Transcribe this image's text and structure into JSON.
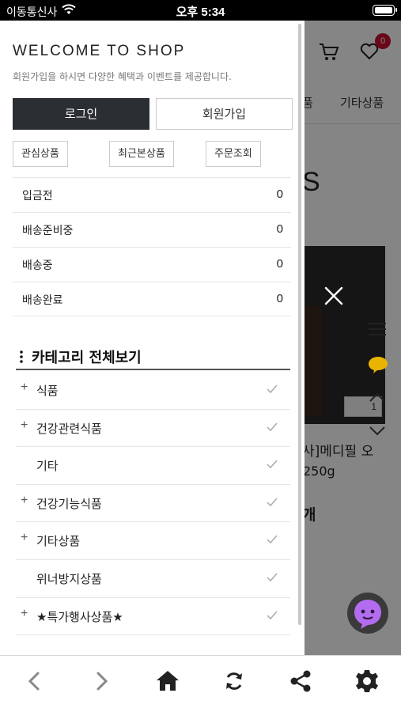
{
  "status_bar": {
    "carrier": "이동통신사",
    "time": "오후 5:34"
  },
  "background": {
    "cart_count": "0",
    "tabs": [
      "품",
      "기타상품"
    ],
    "big_text": "S",
    "like_count": "1",
    "product_name": "사]메디필 오",
    "product_weight": "250g",
    "count_label": "개"
  },
  "drawer": {
    "title": "WELCOME TO SHOP",
    "subtitle": "회원가입을 하시면 다양한 혜택과 이벤트를 제공합니다.",
    "login_label": "로그인",
    "join_label": "회원가입",
    "quick_buttons": [
      "관심상품",
      "최근본상품",
      "주문조회"
    ],
    "order_status": [
      {
        "label": "입금전",
        "count": "0"
      },
      {
        "label": "배송준비중",
        "count": "0"
      },
      {
        "label": "배송중",
        "count": "0"
      },
      {
        "label": "배송완료",
        "count": "0"
      }
    ],
    "category_title": "카테고리 전체보기",
    "categories": [
      {
        "plus": "+",
        "name": "식품"
      },
      {
        "plus": "+",
        "name": "건강관련식품"
      },
      {
        "plus": "",
        "name": "기타"
      },
      {
        "plus": "+",
        "name": "건강기능식품"
      },
      {
        "plus": "+",
        "name": "기타상품"
      },
      {
        "plus": "",
        "name": "위너방지상품"
      },
      {
        "plus": "+",
        "name": "★특가행사상품★"
      }
    ]
  },
  "toolbar": {
    "icons": [
      "back-icon",
      "forward-icon",
      "home-icon",
      "refresh-icon",
      "share-icon",
      "settings-icon"
    ]
  },
  "colors": {
    "login_bg": "#2b2f33",
    "badge": "#c8102e",
    "chat_fab": "#b36cf0"
  }
}
